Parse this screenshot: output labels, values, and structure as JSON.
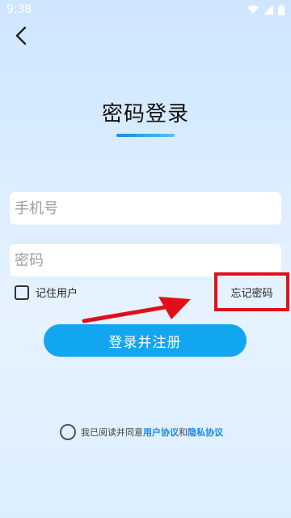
{
  "status_bar": {
    "time": "9:38"
  },
  "header": {
    "title": "密码登录"
  },
  "form": {
    "phone_placeholder": "手机号",
    "password_placeholder": "密码",
    "remember_label": "记住用户",
    "forgot_label": "忘记密码",
    "submit_label": "登录并注册"
  },
  "agreement": {
    "prefix": "我已阅读并同意",
    "user_agreement": "用户协议",
    "connector": "和",
    "privacy_agreement": "隐私协议"
  },
  "colors": {
    "accent": "#13a6f0",
    "highlight_red": "#e0101a",
    "link": "#1e88e5"
  }
}
